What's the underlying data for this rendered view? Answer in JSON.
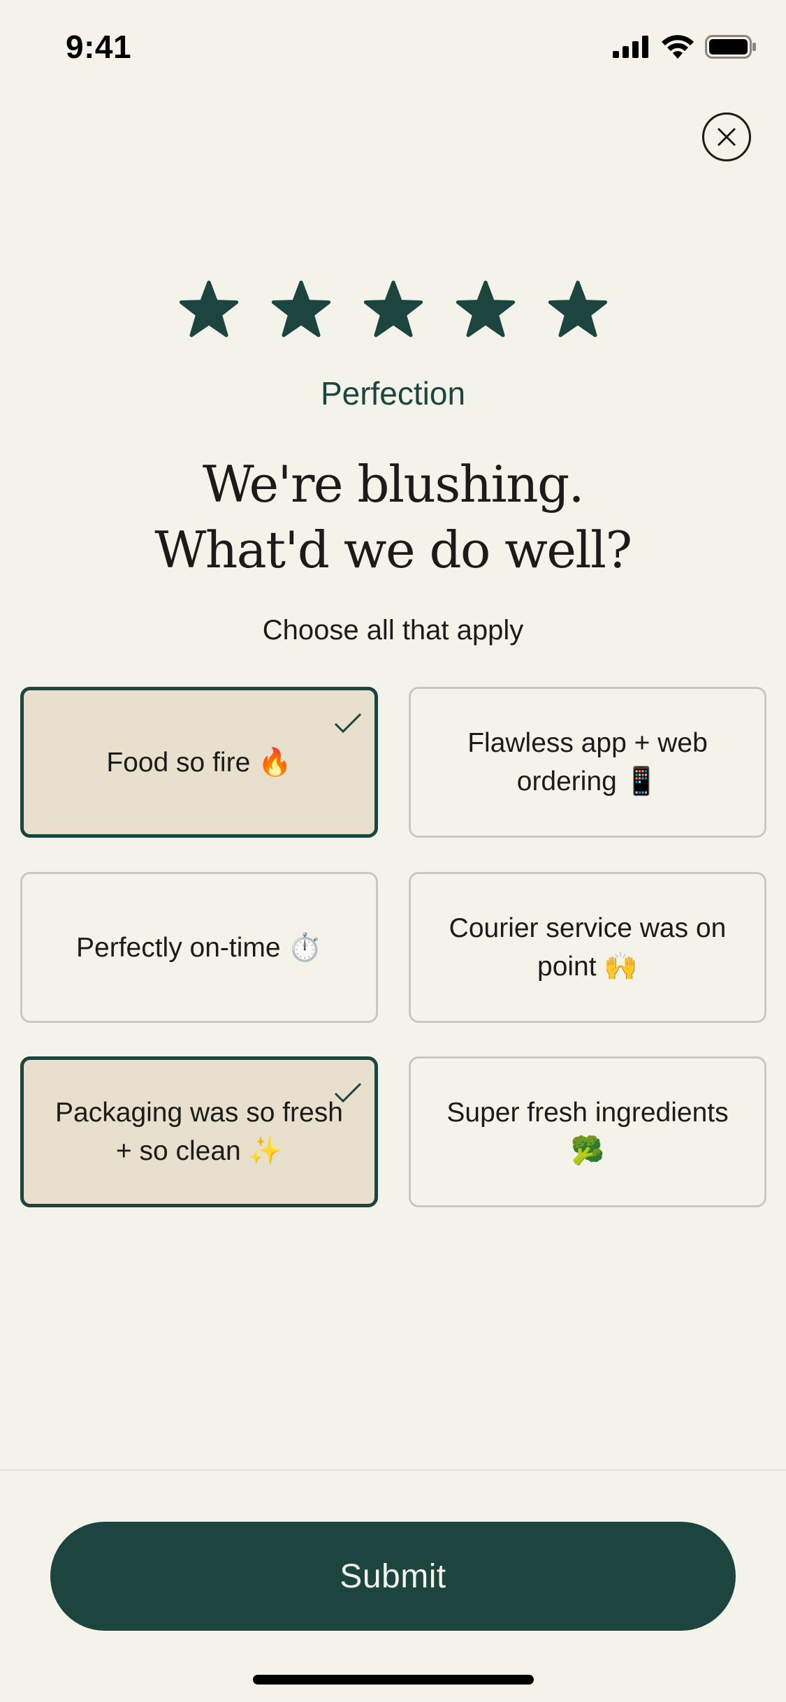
{
  "status_bar": {
    "time": "9:41"
  },
  "rating": {
    "stars_filled": 5,
    "stars_total": 5,
    "star_color": "#1d4540",
    "label": "Perfection"
  },
  "headline": {
    "line1": "We're blushing.",
    "line2": "What'd we do well?"
  },
  "subhead": "Choose all that apply",
  "options": [
    {
      "label": "Food so fire 🔥",
      "selected": true
    },
    {
      "label": "Flawless app + web ordering 📱",
      "selected": false
    },
    {
      "label": "Perfectly on-time ⏱️",
      "selected": false
    },
    {
      "label": "Courier service was on point 🙌",
      "selected": false
    },
    {
      "label": "Packaging was so fresh + so clean ✨",
      "selected": true
    },
    {
      "label": "Super fresh ingredients 🥦",
      "selected": false
    }
  ],
  "submit": {
    "label": "Submit"
  },
  "colors": {
    "accent": "#1d4540",
    "background": "#f4f3ea",
    "selected_fill": "#e8dfcc"
  },
  "icons": {
    "close": "close-icon",
    "check": "check-icon",
    "star": "star-icon"
  }
}
